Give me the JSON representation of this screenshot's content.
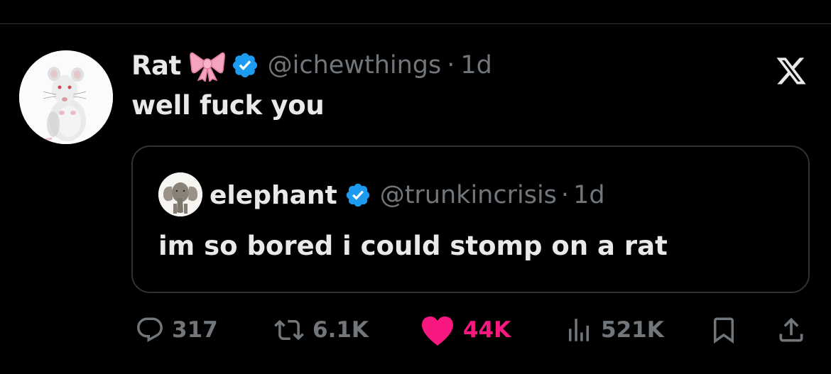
{
  "tweet": {
    "name": "Rat",
    "handle": "@ichewthings",
    "separator": "·",
    "time": "1d",
    "text": "well fuck you"
  },
  "quoted": {
    "name": "elephant",
    "handle": "@trunkincrisis",
    "separator": "·",
    "time": "1d",
    "text": "im so bored i could stomp on a rat"
  },
  "actions": {
    "replies": "317",
    "reposts": "6.1K",
    "likes": "44K",
    "views": "521K"
  },
  "colors": {
    "background": "#000000",
    "text": "#e7e9ea",
    "muted": "#71767b",
    "border": "#2f3336",
    "verified": "#1d9bf0",
    "like": "#f91880",
    "bow": "#f4a3c0"
  },
  "icons": [
    "bow-emoji-icon",
    "verified-badge-icon",
    "x-logo-icon",
    "reply-icon",
    "repost-icon",
    "like-icon",
    "views-icon",
    "bookmark-icon",
    "share-icon"
  ]
}
